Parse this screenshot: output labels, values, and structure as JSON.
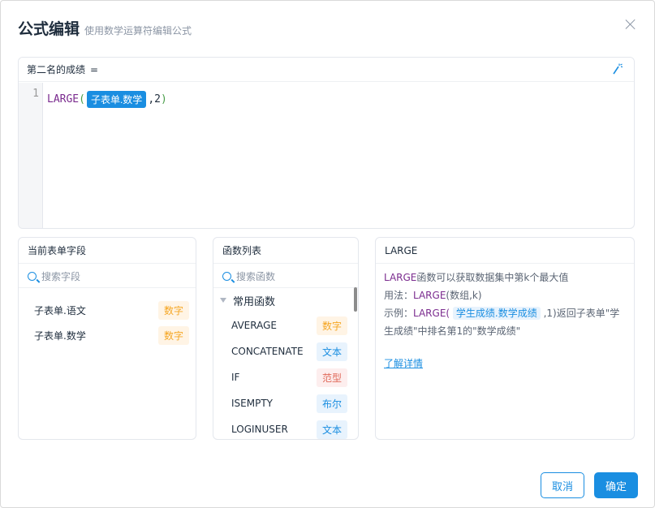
{
  "dialog": {
    "title": "公式编辑",
    "subtitle": "使用数学运算符编辑公式"
  },
  "editor": {
    "field_label": "第二名的成绩",
    "equals": "=",
    "line_number": "1",
    "code": {
      "function": "LARGE",
      "open_paren": "(",
      "field_chip": "子表单.数学",
      "comma_arg": ",2",
      "close_paren": ")"
    }
  },
  "fields_panel": {
    "title": "当前表单字段",
    "search_placeholder": "搜索字段",
    "items": [
      {
        "label": "子表单.语文",
        "type": "数字"
      },
      {
        "label": "子表单.数学",
        "type": "数字"
      }
    ]
  },
  "functions_panel": {
    "title": "函数列表",
    "search_placeholder": "搜索函数",
    "group": "常用函数",
    "items": [
      {
        "name": "AVERAGE",
        "type": "数字"
      },
      {
        "name": "CONCATENATE",
        "type": "文本"
      },
      {
        "name": "IF",
        "type": "范型"
      },
      {
        "name": "ISEMPTY",
        "type": "布尔"
      },
      {
        "name": "LOGINUSER",
        "type": "文本"
      }
    ]
  },
  "info_panel": {
    "title": "LARGE",
    "desc_fn": "LARGE",
    "desc_rest": "函数可以获取数据集中第k个最大值",
    "usage_label": "用法：",
    "usage_fn": "LARGE",
    "usage_args": "(数组,k)",
    "example_label": "示例：",
    "example_fn": "LARGE(",
    "example_chip": "学生成绩.数学成绩",
    "example_rest": ",1)返回子表单\"学生成绩\"中排名第1的\"数学成绩\"",
    "link": "了解详情"
  },
  "buttons": {
    "cancel": "取消",
    "ok": "确定"
  },
  "colors": {
    "accent": "#1a8ee1",
    "function": "#7b2c8f"
  }
}
